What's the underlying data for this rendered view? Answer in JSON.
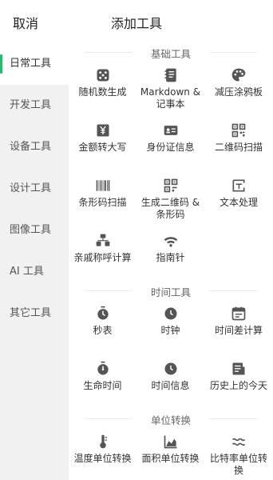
{
  "header": {
    "cancel_label": "取消",
    "title": "添加工具"
  },
  "sidebar": {
    "items": [
      {
        "label": "日常工具",
        "active": true
      },
      {
        "label": "开发工具"
      },
      {
        "label": "设备工具"
      },
      {
        "label": "设计工具"
      },
      {
        "label": "图像工具"
      },
      {
        "label": "AI 工具"
      },
      {
        "label": "其它工具"
      }
    ]
  },
  "sections": [
    {
      "title": "基础工具",
      "tools": [
        {
          "label": "随机数生成",
          "icon": "dice-icon"
        },
        {
          "label": "Markdown & 记事本",
          "icon": "notebook-icon"
        },
        {
          "label": "减压涂鸦板",
          "icon": "palette-icon"
        },
        {
          "label": "金额转大写",
          "icon": "yen-icon"
        },
        {
          "label": "身份证信息",
          "icon": "id-card-icon"
        },
        {
          "label": "二维码扫描",
          "icon": "qr-code-icon"
        },
        {
          "label": "条形码扫描",
          "icon": "barcode-icon"
        },
        {
          "label": "生成二维码 & 条形码",
          "icon": "qr-generate-icon"
        },
        {
          "label": "文本处理",
          "icon": "text-icon"
        },
        {
          "label": "亲戚称呼计算",
          "icon": "family-icon"
        },
        {
          "label": "指南针",
          "icon": "compass-icon"
        }
      ]
    },
    {
      "title": "时间工具",
      "tools": [
        {
          "label": "秒表",
          "icon": "stopwatch-icon"
        },
        {
          "label": "时钟",
          "icon": "clock-icon"
        },
        {
          "label": "时间差计算",
          "icon": "calendar-icon"
        },
        {
          "label": "生命时间",
          "icon": "life-timer-icon"
        },
        {
          "label": "时间信息",
          "icon": "time-info-icon"
        },
        {
          "label": "历史上的今天",
          "icon": "history-icon"
        }
      ]
    },
    {
      "title": "单位转换",
      "tools": [
        {
          "label": "温度单位转换",
          "icon": "thermometer-icon"
        },
        {
          "label": "面积单位转换",
          "icon": "area-chart-icon"
        },
        {
          "label": "比特率单位转换",
          "icon": "wave-icon"
        }
      ]
    }
  ],
  "colors": {
    "accent": "#2fb869",
    "icon": "#555555",
    "sidebar_bg": "#f1f1f1"
  }
}
